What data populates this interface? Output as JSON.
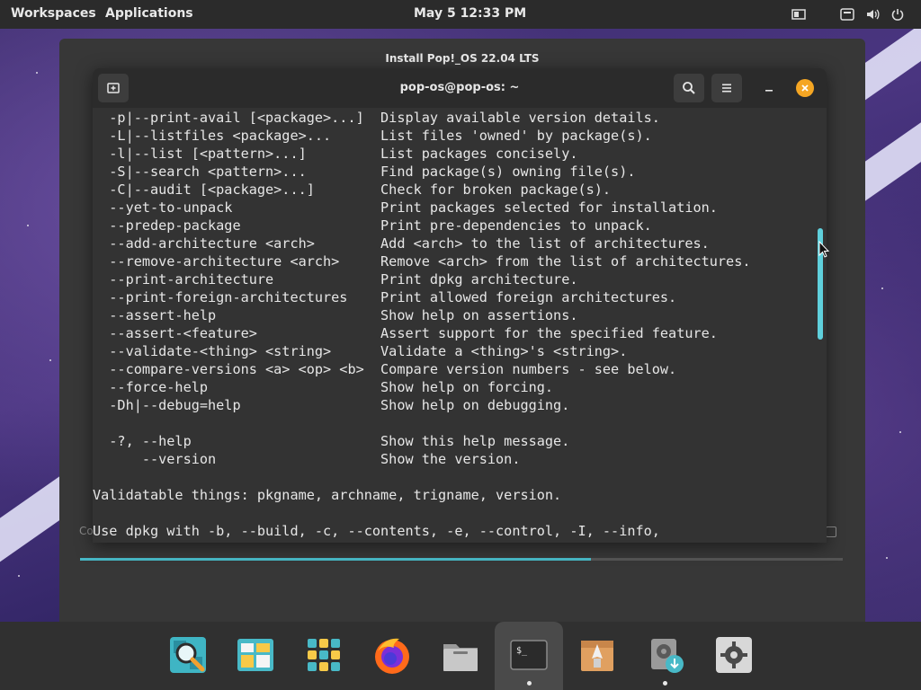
{
  "topbar": {
    "workspaces": "Workspaces",
    "applications": "Applications",
    "datetime": "May 5  12:33 PM"
  },
  "installer": {
    "title": "Install Pop!_OS 22.04 LTS",
    "left_hint": "Co",
    "progress": 0.67
  },
  "terminal": {
    "title": "pop-os@pop-os: ~",
    "lines": [
      "  -p|--print-avail [<package>...]  Display available version details.",
      "  -L|--listfiles <package>...      List files 'owned' by package(s).",
      "  -l|--list [<pattern>...]         List packages concisely.",
      "  -S|--search <pattern>...         Find package(s) owning file(s).",
      "  -C|--audit [<package>...]        Check for broken package(s).",
      "  --yet-to-unpack                  Print packages selected for installation.",
      "  --predep-package                 Print pre-dependencies to unpack.",
      "  --add-architecture <arch>        Add <arch> to the list of architectures.",
      "  --remove-architecture <arch>     Remove <arch> from the list of architectures.",
      "  --print-architecture             Print dpkg architecture.",
      "  --print-foreign-architectures    Print allowed foreign architectures.",
      "  --assert-help                    Show help on assertions.",
      "  --assert-<feature>               Assert support for the specified feature.",
      "  --validate-<thing> <string>      Validate a <thing>'s <string>.",
      "  --compare-versions <a> <op> <b>  Compare version numbers - see below.",
      "  --force-help                     Show help on forcing.",
      "  -Dh|--debug=help                 Show help on debugging.",
      "",
      "  -?, --help                       Show this help message.",
      "      --version                    Show the version.",
      "",
      "Validatable things: pkgname, archname, trigname, version.",
      "",
      "Use dpkg with -b, --build, -c, --contents, -e, --control, -I, --info,"
    ]
  },
  "dock": {
    "items": [
      "search-app",
      "files-manager",
      "app-grid",
      "firefox",
      "files",
      "terminal",
      "pop-shop",
      "installer"
    ]
  },
  "colors": {
    "accent": "#48b9c7",
    "close": "#f5a623"
  }
}
